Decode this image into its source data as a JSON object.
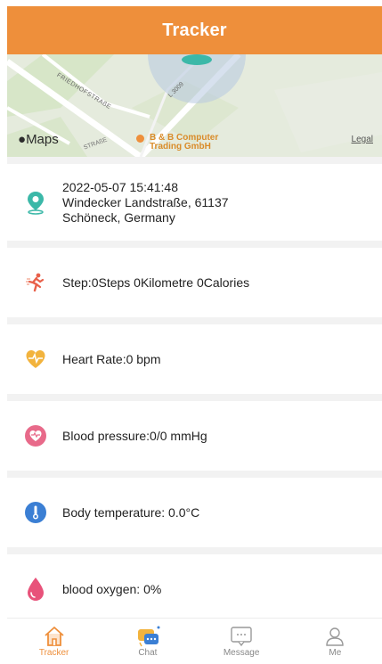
{
  "header": {
    "title": "Tracker"
  },
  "map": {
    "brand": "Maps",
    "poi_name": "B & B Computer Trading GmbH",
    "poi_line1": "B & B Computer",
    "poi_line2": "Trading GmbH",
    "legal_label": "Legal",
    "street_1": "FRIEDHOFSTRAßE",
    "street_2": "L 3009",
    "street_3": "STRAßE"
  },
  "location": {
    "datetime": "2022-05-07 15:41:48",
    "address_line1": "Windecker Landstraße, 61137",
    "address_line2": "Schöneck, Germany"
  },
  "metrics": {
    "steps": "Step:0Steps 0Kilometre 0Calories",
    "heart_rate": "Heart Rate:0 bpm",
    "blood_pressure": "Blood pressure:0/0 mmHg",
    "body_temperature": "Body temperature: 0.0°C",
    "blood_oxygen": "blood oxygen: 0%"
  },
  "tabs": [
    {
      "label": "Tracker",
      "icon": "home-icon",
      "active": true
    },
    {
      "label": "Chat",
      "icon": "chat-icon",
      "active": false
    },
    {
      "label": "Message",
      "icon": "message-icon",
      "active": false
    },
    {
      "label": "Me",
      "icon": "person-icon",
      "active": false
    }
  ],
  "colors": {
    "accent": "#EE8F3B",
    "location": "#3BB8A8",
    "heart": "#F2B33D",
    "blood_pressure": "#E86A8A",
    "temperature": "#3B7FD4",
    "oxygen": "#E8527A"
  }
}
